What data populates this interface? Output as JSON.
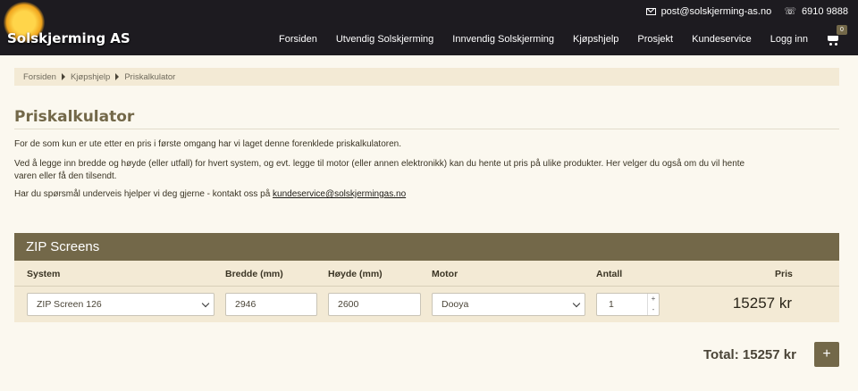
{
  "header": {
    "brand": "Solskjerming AS",
    "email": "post@solskjerming-as.no",
    "phone": "6910 9888",
    "nav": [
      "Forsiden",
      "Utvendig Solskjerming",
      "Innvendig Solskjerming",
      "Kjøpshjelp",
      "Prosjekt",
      "Kundeservice",
      "Logg inn"
    ],
    "cart_count": "0"
  },
  "breadcrumb": [
    "Forsiden",
    "Kjøpshjelp",
    "Priskalkulator"
  ],
  "page": {
    "title": "Priskalkulator",
    "intro1": "For de som kun er ute etter en pris i første omgang har vi laget denne forenklede priskalkulatoren.",
    "intro2_line1": "Ved å legge inn bredde og høyde (eller utfall) for hvert system, og evt. legge til motor (eller annen elektronikk) kan du hente ut pris på ulike produkter. Her velger du også om du vil hente",
    "intro2_line2": "varen eller få den tilsendt.",
    "intro3_text": "Har du spørsmål underveis hjelper vi deg gjerne - kontakt oss på ",
    "intro3_link": "kundeservice@solskjermingas.no"
  },
  "calculator": {
    "heading": "ZIP Screens",
    "columns": {
      "system": "System",
      "bredde": "Bredde (mm)",
      "hoyde": "Høyde (mm)",
      "motor": "Motor",
      "antall": "Antall",
      "pris": "Pris"
    },
    "row": {
      "system": "ZIP Screen 126",
      "bredde": "2946",
      "hoyde": "2600",
      "motor": "Dooya",
      "antall": "1",
      "pris": "15257 kr"
    },
    "total": "Total: 15257 kr",
    "add_label": "+"
  },
  "colors": {
    "header_bg": "#1d1b20",
    "accent": "#736849",
    "panel_bg": "#f3ead5",
    "page_bg": "#fbf8ef"
  }
}
